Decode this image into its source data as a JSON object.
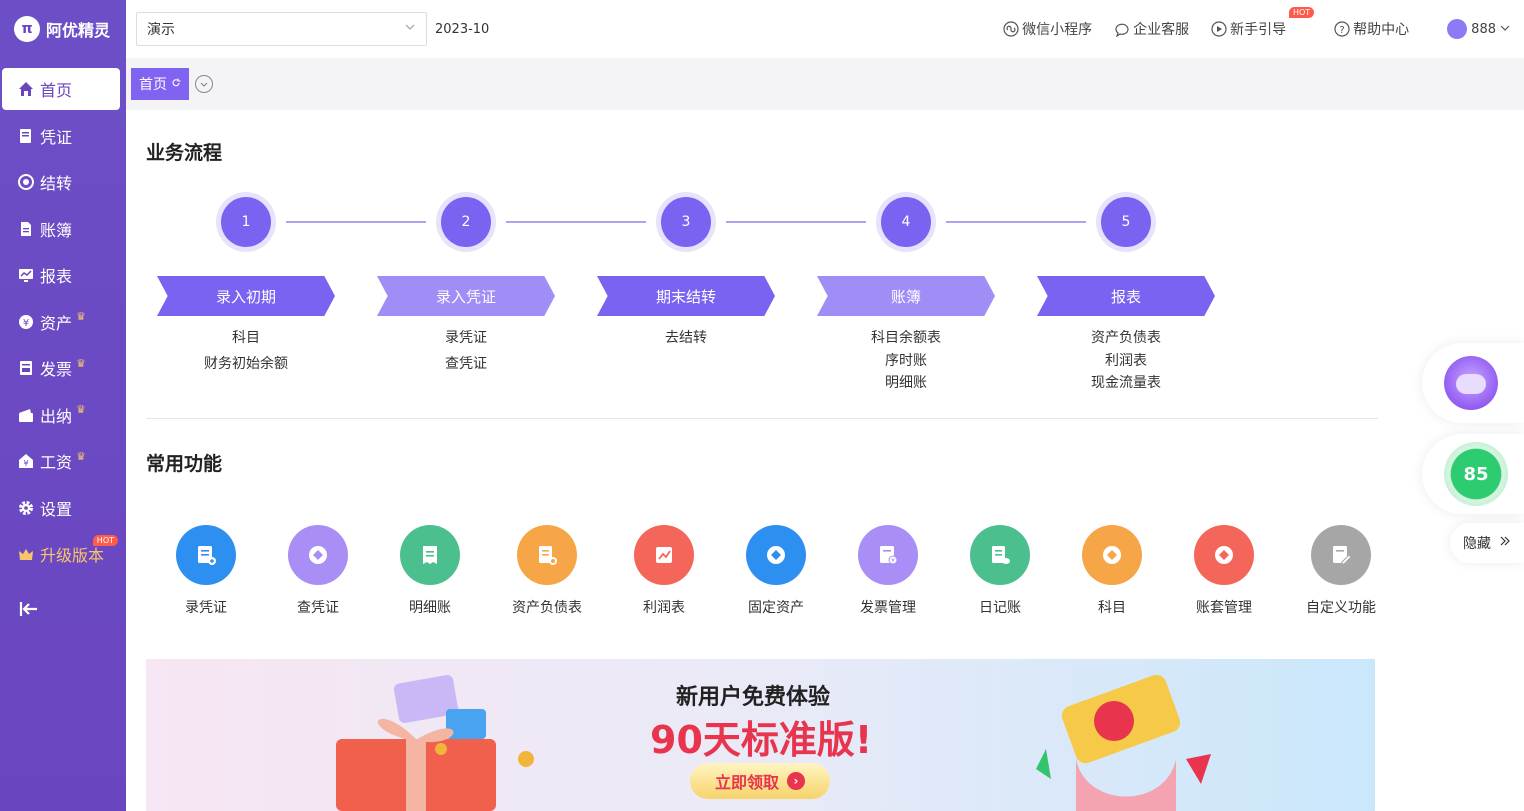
{
  "brand": {
    "name": "阿优精灵",
    "logo_char": "π"
  },
  "sidebar": {
    "items": [
      {
        "label": "首页",
        "icon": "home-icon",
        "active": true
      },
      {
        "label": "凭证",
        "icon": "voucher-icon"
      },
      {
        "label": "结转",
        "icon": "transfer-icon"
      },
      {
        "label": "账簿",
        "icon": "ledger-icon"
      },
      {
        "label": "报表",
        "icon": "report-icon"
      },
      {
        "label": "资产",
        "icon": "asset-icon",
        "crown": true
      },
      {
        "label": "发票",
        "icon": "invoice-icon",
        "crown": true
      },
      {
        "label": "出纳",
        "icon": "cashier-icon",
        "crown": true
      },
      {
        "label": "工资",
        "icon": "salary-icon",
        "crown": true
      },
      {
        "label": "设置",
        "icon": "gear-icon"
      }
    ],
    "upgrade": {
      "label": "升级版本",
      "badge": "HOT"
    }
  },
  "topbar": {
    "account_select": "演示",
    "period": "2023-10",
    "links": [
      {
        "label": "微信小程序",
        "icon": "mini-program-icon"
      },
      {
        "label": "企业客服",
        "icon": "customer-service-icon"
      },
      {
        "label": "新手引导",
        "icon": "play-guide-icon",
        "badge": "HOT"
      },
      {
        "label": "帮助中心",
        "icon": "help-icon"
      }
    ],
    "user": "888"
  },
  "tabs": [
    {
      "label": "首页"
    }
  ],
  "flow": {
    "title": "业务流程",
    "steps": [
      {
        "num": "1",
        "label": "录入初期",
        "items": [
          "科目",
          "财务初始余额"
        ]
      },
      {
        "num": "2",
        "label": "录入凭证",
        "items": [
          "录凭证",
          "查凭证"
        ]
      },
      {
        "num": "3",
        "label": "期末结转",
        "items": [
          "去结转"
        ]
      },
      {
        "num": "4",
        "label": "账簿",
        "items": [
          "科目余额表",
          "序时账",
          "明细账"
        ]
      },
      {
        "num": "5",
        "label": "报表",
        "items": [
          "资产负债表",
          "利润表",
          "现金流量表"
        ]
      }
    ]
  },
  "functions": {
    "title": "常用功能",
    "items": [
      {
        "label": "录凭证",
        "color": "#2d8ff0",
        "icon": "voucher-add-icon"
      },
      {
        "label": "查凭证",
        "color": "#a98ef5",
        "icon": "voucher-search-icon"
      },
      {
        "label": "明细账",
        "color": "#4cbf8f",
        "icon": "detail-ledger-icon"
      },
      {
        "label": "资产负债表",
        "color": "#f6a547",
        "icon": "balance-sheet-icon"
      },
      {
        "label": "利润表",
        "color": "#f5665a",
        "icon": "profit-icon"
      },
      {
        "label": "固定资产",
        "color": "#2d8ff0",
        "icon": "fixed-asset-icon"
      },
      {
        "label": "发票管理",
        "color": "#a98ef5",
        "icon": "invoice-manage-icon"
      },
      {
        "label": "日记账",
        "color": "#4cbf8f",
        "icon": "journal-icon"
      },
      {
        "label": "科目",
        "color": "#f6a547",
        "icon": "subject-icon"
      },
      {
        "label": "账套管理",
        "color": "#f5665a",
        "icon": "account-set-icon"
      },
      {
        "label": "自定义功能",
        "color": "#a6a6a6",
        "icon": "custom-icon"
      }
    ]
  },
  "promo": {
    "line1": "新用户免费体验",
    "line2": "90天标准版!",
    "button": "立即领取"
  },
  "widgets": {
    "score": "85",
    "hide_label": "隐藏"
  }
}
